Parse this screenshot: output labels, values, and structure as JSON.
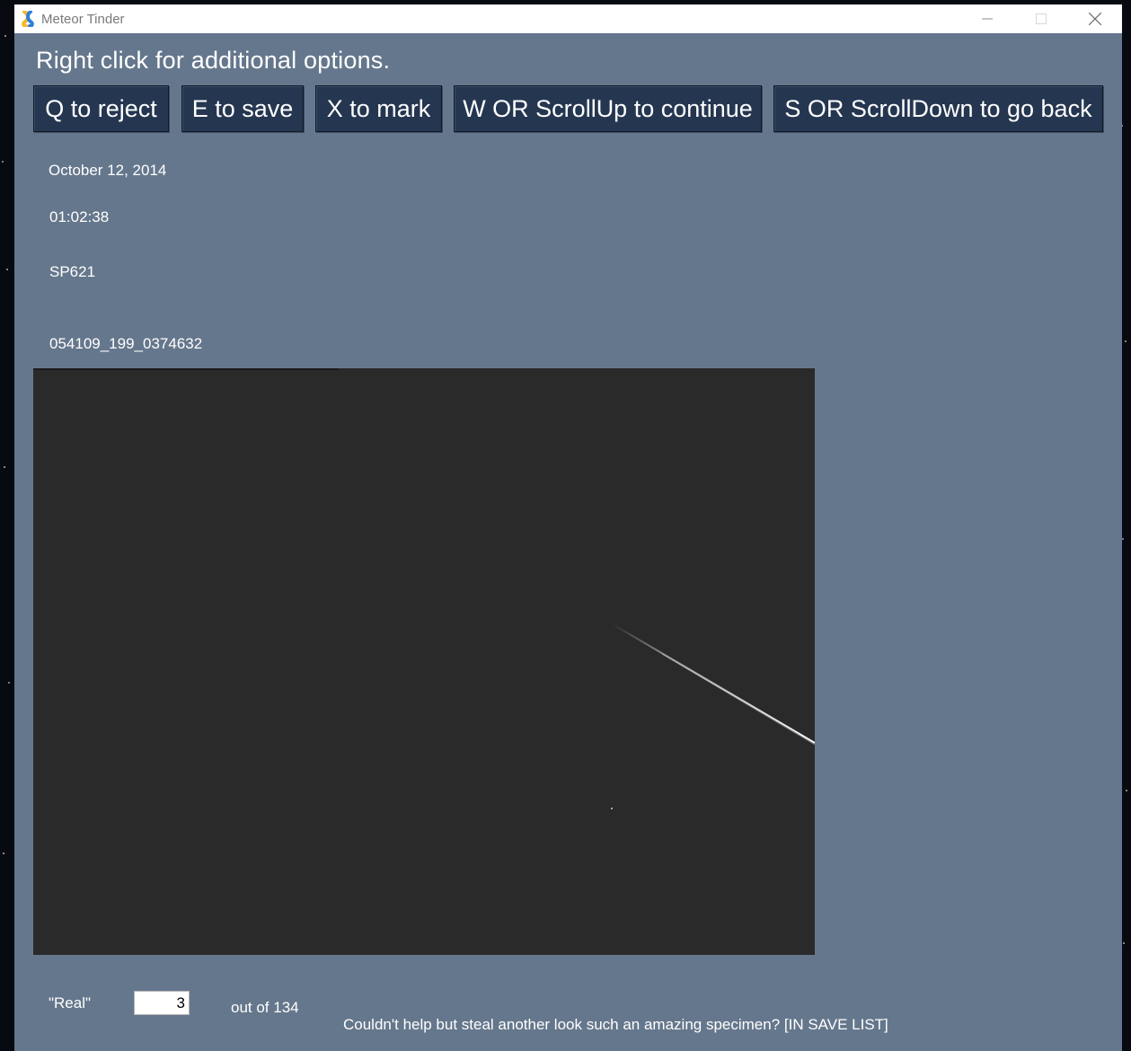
{
  "window": {
    "title": "Meteor Tinder",
    "controls": [
      "minimize-icon",
      "maximize-icon",
      "close-icon"
    ]
  },
  "hint": "Right click for additional options.",
  "toolbar": {
    "reject_label": "Q to reject",
    "save_label": "E to save",
    "mark_label": "X to mark",
    "continue_label": "W OR ScrollUp to continue",
    "back_label": "S OR ScrollDown to go back"
  },
  "info": {
    "date": "October 12, 2014",
    "time": "01:02:38",
    "station": "SP621",
    "file_id": "054109_199_0374632"
  },
  "footer": {
    "real_label": "\"Real\"",
    "current_index": "3",
    "out_of": "out of 134",
    "status": "Couldn't help but steal another look such an amazing specimen? [IN SAVE LIST]"
  },
  "colors": {
    "window_bg": "#65778c",
    "button_bg": "#253650",
    "viewer_bg": "#2a2a2b"
  }
}
